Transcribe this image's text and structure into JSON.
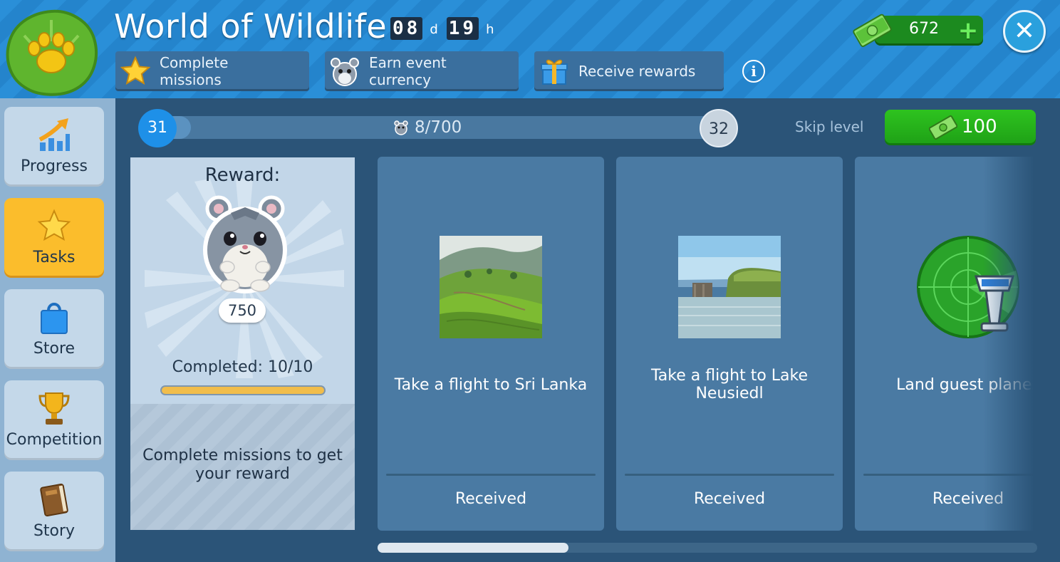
{
  "header": {
    "title": "World of Wildlife",
    "timer": {
      "days": "08",
      "days_unit": "d",
      "hours": "19",
      "hours_unit": "h"
    },
    "steps": [
      {
        "label": "Complete missions",
        "icon": "star-icon"
      },
      {
        "label": "Earn event currency",
        "icon": "hamster-icon"
      },
      {
        "label": "Receive rewards",
        "icon": "gift-icon"
      }
    ],
    "cash": "672"
  },
  "sidebar": {
    "items": [
      {
        "label": "Progress",
        "icon": "progress-arrow-icon",
        "active": false
      },
      {
        "label": "Tasks",
        "icon": "star-icon",
        "active": true
      },
      {
        "label": "Store",
        "icon": "shopping-bag-icon",
        "active": false
      },
      {
        "label": "Competition",
        "icon": "trophy-icon",
        "active": false
      },
      {
        "label": "Story",
        "icon": "book-icon",
        "active": false
      }
    ]
  },
  "level": {
    "current": "31",
    "next": "32",
    "progress_text": "8/700",
    "progress_fraction": 0.011,
    "skip_label": "Skip level",
    "skip_cost": "100"
  },
  "reward": {
    "title": "Reward:",
    "amount": "750",
    "completed_text": "Completed: 10/10",
    "completed_fraction": 1.0,
    "message": "Complete missions to get your reward"
  },
  "missions": [
    {
      "title": "Take a flight to Sri Lanka",
      "status": "Received",
      "image": "sri-lanka-tea-hills-photo"
    },
    {
      "title": "Take a flight to Lake Neusiedl",
      "status": "Received",
      "image": "lake-neusiedl-photo"
    },
    {
      "title": "Land guest planes",
      "status": "Received",
      "image": "radar-tower-icon"
    }
  ],
  "scroll": {
    "position_fraction": 0.0
  },
  "colors": {
    "accent_blue": "#1e90e8",
    "active_tab": "#fbbd2c",
    "buy_green": "#2ec31f",
    "header_blue": "#2a8fd8"
  }
}
